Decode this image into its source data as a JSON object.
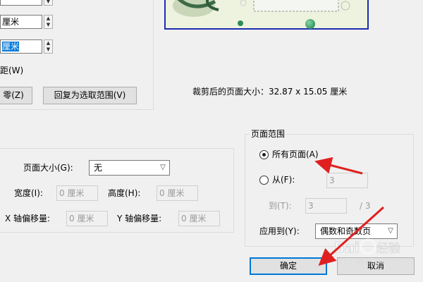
{
  "crop": {
    "width_value": "厘米",
    "height_value": "厘米",
    "center_label": "距(W)",
    "reset_button": "零(Z)",
    "revert_button": "回复为选取范围(V)",
    "cropped_size": "裁剪后的页面大小：32.87 x 15.05 厘米"
  },
  "page_size_group": {
    "page_size_label": "页面大小(G):",
    "page_size_value": "无",
    "width_label": "宽度(I):",
    "width_value": "0 厘米",
    "height_label": "高度(H):",
    "height_value": "0 厘米",
    "x_offset_label": "X 轴偏移量:",
    "x_offset_value": "0 厘米",
    "y_offset_label": "Y 轴偏移量:",
    "y_offset_value": "0 厘米"
  },
  "page_range": {
    "title": "页面范围",
    "all_pages": "所有页面(A)",
    "from_label": "从(F):",
    "from_value": "3",
    "to_label": "到(T):",
    "to_value": "3",
    "total": "/ 3",
    "apply_label": "应用到(Y):",
    "apply_value": "偶数和奇数页"
  },
  "footer": {
    "ok_button": "确定",
    "cancel_button": "取消"
  },
  "watermark": "Baidu 经验 jingyan.baidu.com",
  "colors": {
    "annotation_arrow": "#e02020",
    "selection_highlight": "#0078d7",
    "default_button_border": "#0078d7"
  }
}
